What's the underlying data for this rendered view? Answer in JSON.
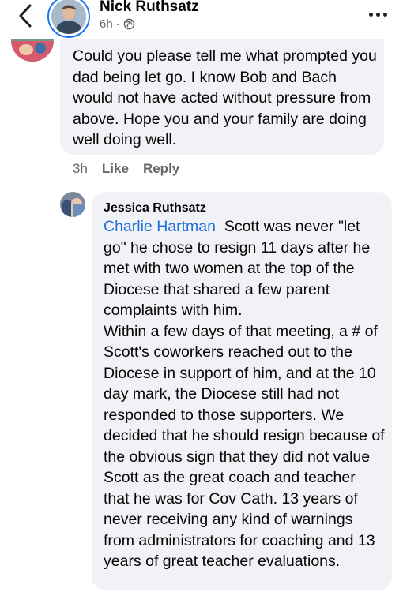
{
  "header": {
    "name": "Nick Ruthsatz",
    "time": "6h",
    "separator": "·"
  },
  "comment1": {
    "text": "Could you please tell me what prompted you dad being let go. I know Bob and Bach would not have acted without pressure from above. Hope you and your family are doing well doing well.",
    "time": "3h",
    "like_label": "Like",
    "reply_label": "Reply"
  },
  "reply": {
    "author": "Jessica Ruthsatz",
    "mention": "Charlie Hartman",
    "paragraph1": "Scott was never \"let go\" he chose to resign 11 days after he met with two women at the top of the Diocese that shared a few parent complaints with him.",
    "paragraph2": "Within a few days of that meeting, a # of Scott's coworkers reached out to the Diocese in support of him, and at the 10 day mark, the Diocese still had not responded to those supporters. We decided that he should resign because of the obvious sign that they did not value Scott as the great coach and teacher that he was for Cov Cath. 13 years of never receiving any kind of warnings from administrators for coaching and 13 years of great teacher evaluations."
  },
  "colors": {
    "bubble": "#f0f2f5",
    "mention": "#216fdb",
    "secondary_text": "#65676b",
    "avatar_ring": "#1877f2"
  },
  "icons": {
    "back": "chevron-left-icon",
    "privacy": "globe-icon",
    "more": "more-horizontal-icon"
  }
}
